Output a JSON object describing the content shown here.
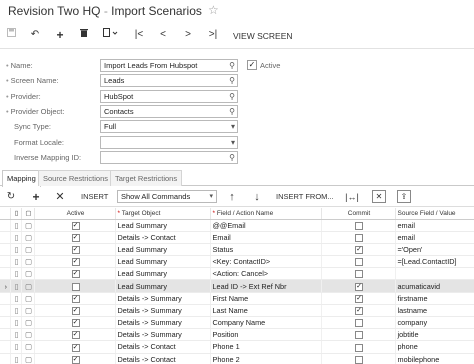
{
  "app": {
    "company": "Revision Two HQ",
    "separator": "-",
    "screen": "Import Scenarios"
  },
  "toolbar": {
    "icons": [
      "save-icon",
      "undo-icon",
      "add-icon",
      "delete-icon",
      "copy-paste-icon",
      "first-icon",
      "previous-icon",
      "next-icon",
      "last-icon"
    ],
    "view_screen": "VIEW SCREEN"
  },
  "form": {
    "name": {
      "label": "Name:",
      "value": "Import Leads From Hubspot"
    },
    "screen_name": {
      "label": "Screen Name:",
      "value": "Leads"
    },
    "provider": {
      "label": "Provider:",
      "value": "HubSpot"
    },
    "provider_object": {
      "label": "Provider Object:",
      "value": "Contacts"
    },
    "sync_type": {
      "label": "Sync Type:",
      "value": "Full"
    },
    "format_locale": {
      "label": "Format Locale:",
      "value": ""
    },
    "inverse_mapping": {
      "label": "Inverse Mapping ID:",
      "value": ""
    },
    "active": {
      "label": "Active",
      "checked": true
    }
  },
  "tabs": [
    "Mapping",
    "Source Restrictions",
    "Target Restrictions"
  ],
  "grid_toolbar": {
    "insert": "INSERT",
    "filter": "Show All Commands",
    "insert_from": "INSERT FROM..."
  },
  "grid": {
    "columns": [
      "",
      "",
      "",
      "Active",
      "Target Object",
      "Field / Action Name",
      "Commit",
      "Source Field / Value"
    ],
    "rows": [
      {
        "active": true,
        "target": "Lead Summary",
        "field": "@@Email",
        "commit": false,
        "source": "email"
      },
      {
        "active": true,
        "target": "Details -> Contact",
        "field": "Email",
        "commit": false,
        "source": "email"
      },
      {
        "active": true,
        "target": "Lead Summary",
        "field": "Status",
        "commit": true,
        "source": "='Open'"
      },
      {
        "active": true,
        "target": "Lead Summary",
        "field": "<Key: ContactID>",
        "commit": false,
        "source": "=[Lead.ContactID]"
      },
      {
        "active": true,
        "target": "Lead Summary",
        "field": "<Action: Cancel>",
        "commit": false,
        "source": ""
      },
      {
        "active": false,
        "target": "Lead Summary",
        "field": "Lead ID -> Ext Ref Nbr",
        "commit": true,
        "source": "acumaticavid",
        "selected": true
      },
      {
        "active": true,
        "target": "Details -> Summary",
        "field": "First Name",
        "commit": true,
        "source": "firstname"
      },
      {
        "active": true,
        "target": "Details -> Summary",
        "field": "Last Name",
        "commit": true,
        "source": "lastname"
      },
      {
        "active": true,
        "target": "Details -> Summary",
        "field": "Company Name",
        "commit": false,
        "source": "company"
      },
      {
        "active": true,
        "target": "Details -> Summary",
        "field": "Position",
        "commit": false,
        "source": "jobtitle"
      },
      {
        "active": true,
        "target": "Details -> Contact",
        "field": "Phone 1",
        "commit": false,
        "source": "phone"
      },
      {
        "active": true,
        "target": "Details -> Contact",
        "field": "Phone 2",
        "commit": false,
        "source": "mobilephone"
      }
    ]
  }
}
